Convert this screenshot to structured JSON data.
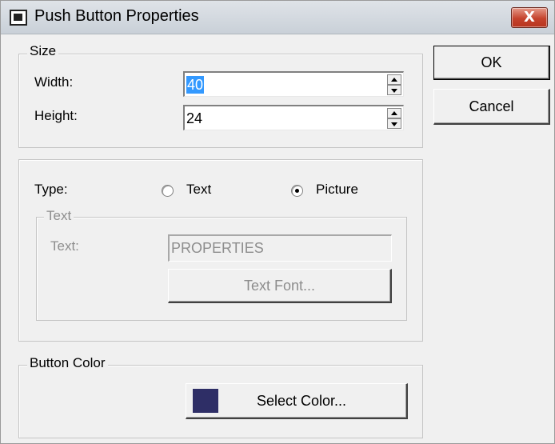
{
  "window": {
    "title": "Push Button Properties",
    "close_label": "X"
  },
  "size_group": {
    "label": "Size",
    "width_label": "Width:",
    "width_value": "40",
    "height_label": "Height:",
    "height_value": "24"
  },
  "type_group": {
    "type_label": "Type:",
    "option_text": "Text",
    "option_picture": "Picture",
    "selected": "Picture",
    "text_group": {
      "label": "Text",
      "text_label": "Text:",
      "text_value": "PROPERTIES",
      "font_button": "Text Font..."
    }
  },
  "color_group": {
    "label": "Button Color",
    "select_button": "Select Color...",
    "swatch_color": "#2e2e66"
  },
  "buttons": {
    "ok": "OK",
    "cancel": "Cancel"
  }
}
